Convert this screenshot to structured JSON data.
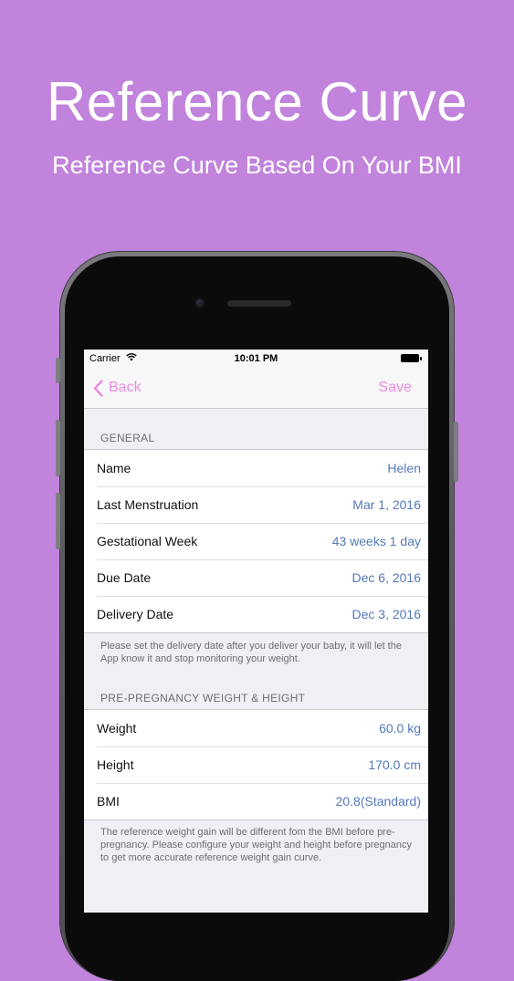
{
  "promo": {
    "title": "Reference Curve",
    "subtitle": "Reference Curve Based On Your BMI"
  },
  "status_bar": {
    "carrier": "Carrier",
    "time": "10:01 PM"
  },
  "nav": {
    "back_label": "Back",
    "save_label": "Save"
  },
  "general": {
    "header": "GENERAL",
    "rows": [
      {
        "label": "Name",
        "value": "Helen"
      },
      {
        "label": "Last Menstruation",
        "value": "Mar 1, 2016"
      },
      {
        "label": "Gestational Week",
        "value": "43 weeks 1 day"
      },
      {
        "label": "Due Date",
        "value": "Dec 6, 2016"
      },
      {
        "label": "Delivery Date",
        "value": "Dec 3, 2016"
      }
    ],
    "footer": "Please set the delivery date after you deliver your baby, it will let the App know it and stop monitoring your weight."
  },
  "prepregnancy": {
    "header": "PRE-PREGNANCY WEIGHT & HEIGHT",
    "rows": [
      {
        "label": "Weight",
        "value": "60.0 kg"
      },
      {
        "label": "Height",
        "value": "170.0 cm"
      },
      {
        "label": "BMI",
        "value": "20.8(Standard)"
      }
    ],
    "footer": "The reference weight gain will be different fom the BMI before pre-pregnancy. Please configure your weight and height before pregnancy to get more accurate reference weight gain curve."
  },
  "colors": {
    "background": "#c183dc",
    "accent": "#e88de0",
    "value_text": "#5479b8"
  }
}
